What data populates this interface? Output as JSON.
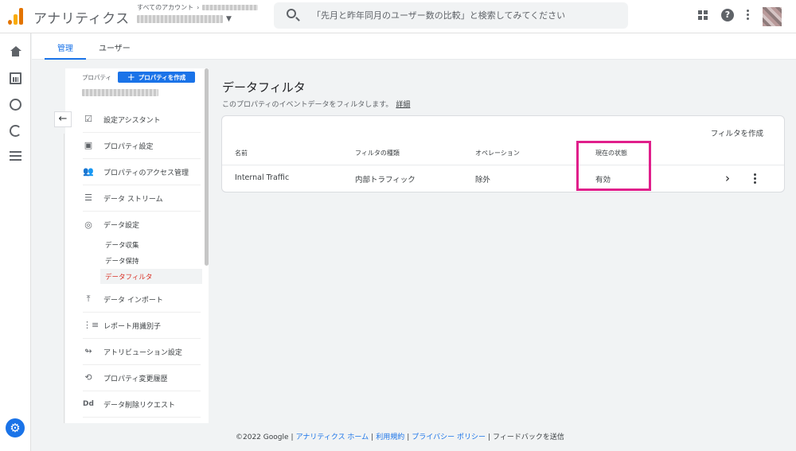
{
  "app": {
    "title": "アナリティクス"
  },
  "account": {
    "crumb": "すべてのアカウント"
  },
  "search": {
    "placeholder": "「先月と昨年同月のユーザー数の比較」と検索してみてください"
  },
  "tabs": [
    {
      "label": "管理"
    },
    {
      "label": "ユーザー"
    }
  ],
  "property": {
    "label": "プロパティ",
    "create_label": "プロパティを作成"
  },
  "nav": {
    "items": [
      {
        "label": "設定アシスタント",
        "icon": "checklist-icon"
      },
      {
        "label": "プロパティ設定",
        "icon": "layout-icon"
      },
      {
        "label": "プロパティのアクセス管理",
        "icon": "people-icon"
      },
      {
        "label": "データ ストリーム",
        "icon": "streams-icon"
      },
      {
        "label": "データ設定",
        "icon": "database-icon"
      },
      {
        "label": "データ インポート",
        "icon": "upload-icon"
      },
      {
        "label": "レポート用識別子",
        "icon": "identity-icon"
      },
      {
        "label": "アトリビューション設定",
        "icon": "attribution-icon"
      },
      {
        "label": "プロパティ変更履歴",
        "icon": "history-icon"
      },
      {
        "label": "データ削除リクエスト",
        "icon": "dd-icon"
      }
    ],
    "sub_items": [
      {
        "label": "データ収集"
      },
      {
        "label": "データ保持"
      },
      {
        "label": "データフィルタ"
      }
    ]
  },
  "main": {
    "title": "データフィルタ",
    "description": "このプロパティのイベントデータをフィルタします。",
    "details_link": "詳細",
    "create_filter": "フィルタを作成",
    "table": {
      "headers": [
        "名前",
        "フィルタの種類",
        "オペレーション",
        "現在の状態"
      ],
      "rows": [
        [
          "Internal Traffic",
          "内部トラフィック",
          "除外",
          "有効"
        ]
      ]
    }
  },
  "footer": {
    "copyright": "©2022 Google",
    "links": [
      "アナリティクス ホーム",
      "利用規約",
      "プライバシー ポリシー"
    ],
    "feedback": "フィードバックを送信"
  },
  "colors": {
    "accent": "#1a73e8",
    "active_sub": "#d93025",
    "highlight": "#e01f8b"
  }
}
